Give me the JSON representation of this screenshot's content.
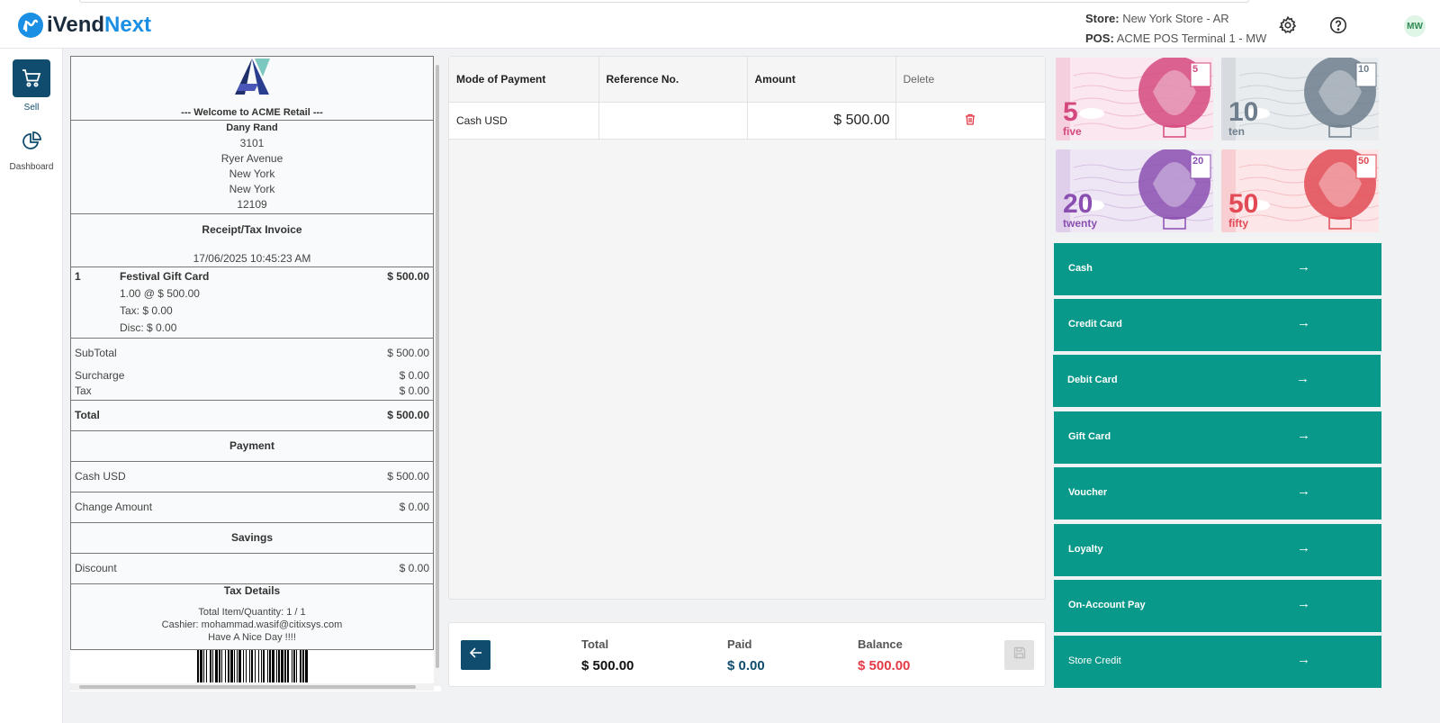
{
  "app": {
    "brand_a": "iVend",
    "brand_b": "Next"
  },
  "header": {
    "store_label": "Store:",
    "store_value": "New York Store - AR",
    "pos_label": "POS:",
    "pos_value": "ACME POS Terminal 1 - MW",
    "avatar_initials": "MW"
  },
  "sidebar": {
    "items": [
      {
        "label": "Sell"
      },
      {
        "label": "Dashboard"
      }
    ]
  },
  "receipt": {
    "welcome": "--- Welcome to ACME Retail ---",
    "customer": "Dany Rand",
    "address": [
      "3101",
      "Ryer Avenue",
      "New York",
      "New York",
      "12109"
    ],
    "title": "Receipt/Tax Invoice",
    "datetime": "17/06/2025 10:45:23 AM",
    "item": {
      "num": "1",
      "name": "Festival Gift Card",
      "price": "$ 500.00",
      "qty_line": "1.00 @ $ 500.00",
      "tax_line": "Tax: $ 0.00",
      "disc_line": "Disc: $ 0.00"
    },
    "subtotal_label": "SubTotal",
    "subtotal_value": "$ 500.00",
    "surcharge_label": "Surcharge",
    "surcharge_value": "$ 0.00",
    "tax_label": "Tax",
    "tax_value": "$ 0.00",
    "total_label": "Total",
    "total_value": "$ 500.00",
    "payment_heading": "Payment",
    "payment_label": "Cash USD",
    "payment_value": "$ 500.00",
    "change_label": "Change Amount",
    "change_value": "$ 0.00",
    "savings_heading": "Savings",
    "discount_label": "Discount",
    "discount_value": "$ 0.00",
    "taxdetails_heading": "Tax Details",
    "footer": [
      "Total Item/Quantity: 1 / 1",
      "Cashier: mohammad.wasif@citixsys.com",
      "Have A Nice Day !!!!"
    ]
  },
  "payments": {
    "headers": [
      "Mode of Payment",
      "Reference No.",
      "Amount",
      "Delete"
    ],
    "rows": [
      {
        "mode": "Cash USD",
        "reference": "",
        "amount": "$ 500.00"
      }
    ]
  },
  "totals": {
    "total_label": "Total",
    "total_value": "$ 500.00",
    "paid_label": "Paid",
    "paid_value": "$ 0.00",
    "balance_label": "Balance",
    "balance_value": "$ 500.00"
  },
  "notes": [
    {
      "num": "5",
      "word": "five",
      "color": "#d4497f"
    },
    {
      "num": "10",
      "word": "ten",
      "color": "#6f7e8c"
    },
    {
      "num": "20",
      "word": "twenty",
      "color": "#8a4fb0"
    },
    {
      "num": "50",
      "word": "fifty",
      "color": "#e24a55"
    }
  ],
  "tenders": [
    "Cash",
    "Credit Card",
    "Debit Card",
    "Gift Card",
    "Voucher",
    "Loyalty",
    "On-Account Pay",
    "Store Credit"
  ],
  "colors": {
    "primary": "#0f4c6e",
    "tender": "#08998a",
    "balance": "#e53946",
    "paid": "#0f4c6e",
    "delete": "#e53946"
  }
}
